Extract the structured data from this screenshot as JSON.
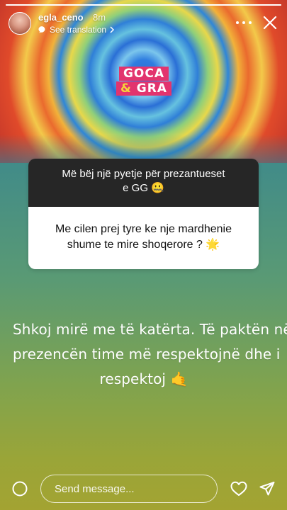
{
  "story": {
    "progress": 1.0,
    "username": "egla_ceno",
    "time": "8m",
    "translation_label": "See translation",
    "logo": {
      "line1": "GOCA",
      "ampersand": "&",
      "line2": "GRA"
    }
  },
  "icons": {
    "avatar": "avatar",
    "translate": "translate-icon",
    "chevron": "chevron-right-icon",
    "more": "more-icon",
    "close": "close-icon",
    "camera": "camera-icon",
    "heart": "heart-icon",
    "send": "send-icon"
  },
  "question": {
    "prompt_line1": "Më bëj një pyetje për prezantueset",
    "prompt_line2": "e GG 🤐",
    "text_line1": "Me cilen prej tyre ke nje mardhenie",
    "text_line2": "shume te mire shoqerore ? 🌟"
  },
  "answer": {
    "line1": "Shkoj mirë me të katërta. Të paktën në",
    "line2": "prezencën time më respektojnë dhe i",
    "line3": "respektoj 🤙"
  },
  "reply": {
    "placeholder": "Send message..."
  },
  "colors": {
    "card_dark": "#262626",
    "card_light": "#ffffff",
    "logo_pink": "#e2346e",
    "logo_amp": "#f6d23c"
  }
}
